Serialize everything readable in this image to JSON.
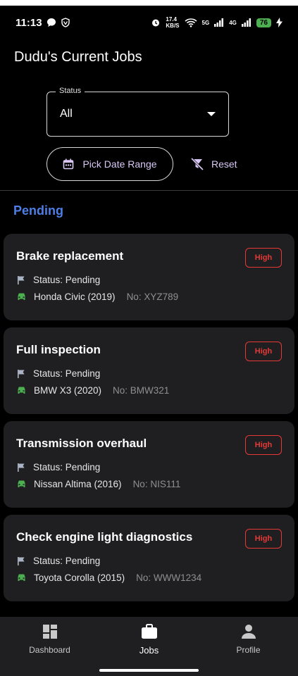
{
  "status_bar": {
    "time": "11:13",
    "speed": "17.4",
    "speed_unit": "KB/S",
    "net1": "5G",
    "net2": "4G",
    "battery": "76"
  },
  "header": {
    "title": "Dudu's Current Jobs"
  },
  "filters": {
    "status_legend": "Status",
    "status_value": "All",
    "date_label": "Pick Date Range",
    "reset_label": "Reset"
  },
  "section": {
    "title": "Pending"
  },
  "jobs": [
    {
      "title": "Brake replacement",
      "priority": "High",
      "status": "Status: Pending",
      "vehicle": "Honda Civic (2019)",
      "plate": "No: XYZ789"
    },
    {
      "title": "Full inspection",
      "priority": "High",
      "status": "Status: Pending",
      "vehicle": "BMW X3 (2020)",
      "plate": "No: BMW321"
    },
    {
      "title": "Transmission overhaul",
      "priority": "High",
      "status": "Status: Pending",
      "vehicle": "Nissan Altima (2016)",
      "plate": "No: NIS111"
    },
    {
      "title": "Check engine light diagnostics",
      "priority": "High",
      "status": "Status: Pending",
      "vehicle": "Toyota Corolla (2015)",
      "plate": "No: WWW1234"
    }
  ],
  "nav": [
    {
      "label": "Dashboard",
      "icon": "dashboard-icon"
    },
    {
      "label": "Jobs",
      "icon": "briefcase-icon"
    },
    {
      "label": "Profile",
      "icon": "person-icon"
    }
  ],
  "colors": {
    "accent": "#4e7fe6",
    "priority_high": "#e53935",
    "car_green": "#4caf50",
    "button_text": "#d9c8f5"
  }
}
